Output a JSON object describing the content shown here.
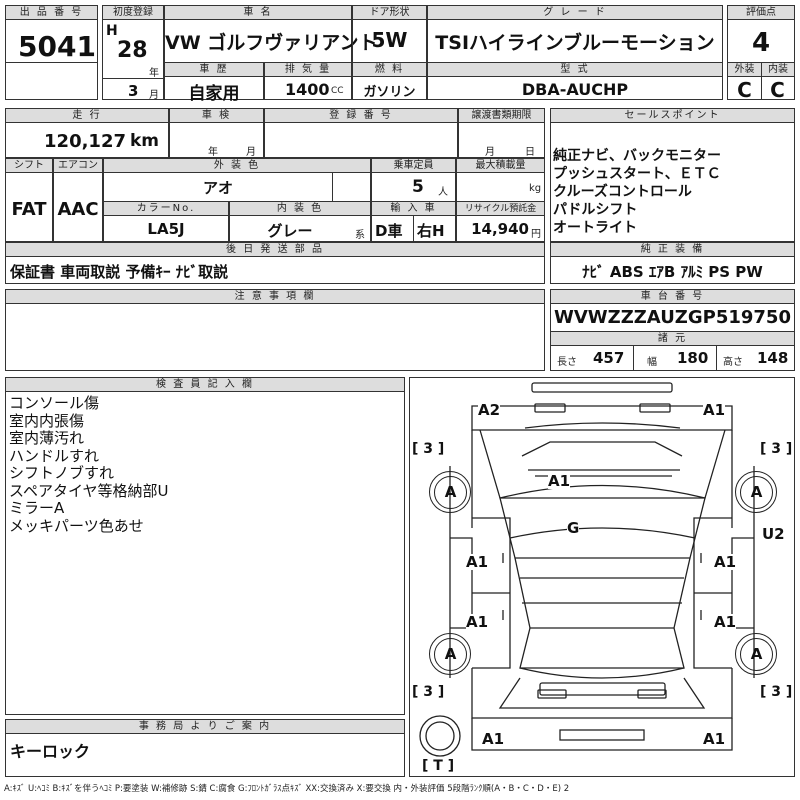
{
  "top": {
    "lot_header": "出 品 番 号",
    "lot_number": "5041",
    "first_reg_header": "初度登録",
    "era": "H",
    "year": "28",
    "year_suffix": "年",
    "month": "3",
    "month_suffix": "月",
    "car_name_header": "車 名",
    "car_name": "VW ゴルフヴァリアント",
    "door_header": "ドア形状",
    "door": "5W",
    "grade_header": "グ レ ー ド",
    "grade": "TSIハイラインブルーモーション",
    "score_header": "評価点",
    "score": "4",
    "history_header": "車 歴",
    "history": "自家用",
    "displacement_header": "排 気 量",
    "displacement": "1400",
    "displacement_unit": "CC",
    "fuel_header": "燃 料",
    "fuel": "ガソリン",
    "model_header": "型 式",
    "model": "DBA-AUCHP",
    "exterior_header": "外装",
    "exterior_grade": "C",
    "interior_header": "内装",
    "interior_grade": "C"
  },
  "mid": {
    "mileage_header": "走 行",
    "mileage": "120,127",
    "mileage_unit": "km",
    "inspection_header": "車 検",
    "inspection_year": "年",
    "inspection_month": "月",
    "plate_header": "登 録 番 号",
    "transfer_header": "譲渡書類期限",
    "transfer_month": "月",
    "transfer_day": "日",
    "shift_header": "シフト",
    "shift": "FAT",
    "ac_header": "エアコン",
    "ac": "AAC",
    "color_header": "外 装 色",
    "color": "アオ",
    "capacity_header": "乗車定員",
    "capacity": "5",
    "capacity_unit": "人",
    "load_header": "最大積載量",
    "load_unit": "kg",
    "color_no_header": "カラーNo.",
    "color_no": "LA5J",
    "interior_color_header": "内 装 色",
    "interior_color": "グレー",
    "interior_color_suffix": "系",
    "import_header": "輸 入 車",
    "import_type": "D車",
    "steering": "右H",
    "recycle_header": "リサイクル預託金",
    "recycle": "14,940",
    "recycle_unit": "円",
    "later_parts_header": "後 日 発 送 部 品",
    "later_parts": "保証書 車両取説 予備ｷｰ ﾅﾋﾞ取説",
    "sales_header": "セールスポイント",
    "sales_points": [
      "純正ナビ、バックモニター",
      "プッシュスタート、ＥＴＣ",
      "クルーズコントロール",
      "パドルシフト",
      "オートライト"
    ],
    "genuine_header": "純 正 装 備",
    "genuine": "ﾅﾋﾞ ABS ｴｱB ｱﾙﾐ PS PW",
    "notes_header": "注 意 事 項 欄",
    "chassis_header": "車 台 番 号",
    "chassis": "WVWZZZAUZGP519750",
    "dims_header": "諸 元",
    "length_label": "長さ",
    "length": "457",
    "width_label": "幅",
    "width": "180",
    "height_label": "高さ",
    "height": "148"
  },
  "inspector": {
    "header": "検 査 員 記 入 欄",
    "lines": [
      "コンソール傷",
      "室内内張傷",
      "室内薄汚れ",
      "ハンドルすれ",
      "シフトノブすれ",
      "スペアタイヤ等格納部U",
      "ミラーA",
      "メッキパーツ色あせ"
    ]
  },
  "office": {
    "header": "事 務 局 よ り ご 案 内",
    "text": "キーロック"
  },
  "diagram": {
    "marks": [
      "A2",
      "A1",
      "A1",
      "A1",
      "G",
      "A1",
      "A1",
      "A1",
      "A1",
      "U2",
      "A1",
      "A1"
    ],
    "wheels": [
      "A",
      "A",
      "A",
      "A"
    ],
    "bracket_3": "[ 3 ]",
    "bracket_t": "[ T ]"
  },
  "legend": "A:ｷｽﾞ U:ﾍｺﾐ B:ｷｽﾞを伴うﾍｺﾐ P:要塗装 W:補修跡 S:錆 C:腐食 G:ﾌﾛﾝﾄｶﾞﾗｽ点ｷｽﾞ XX:交換済み X:要交換 内・外装評価 5段階ﾗﾝｸ順(A・B・C・D・E) 2"
}
